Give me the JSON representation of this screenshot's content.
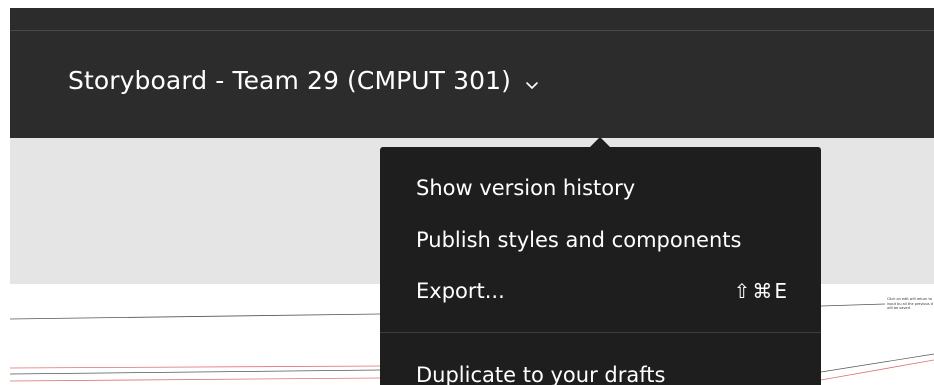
{
  "header": {
    "file_title": "Storyboard - Team 29 (CMPUT 301)",
    "title_chevron_icon": "chevron-down-icon"
  },
  "menu": {
    "items": [
      {
        "label": "Show version history",
        "shortcut": ""
      },
      {
        "label": "Publish styles and components",
        "shortcut": ""
      },
      {
        "label": "Export...",
        "shortcut": "⇧⌘E"
      },
      {
        "label": "Duplicate to your drafts",
        "shortcut": ""
      }
    ]
  },
  "canvas": {
    "note_text": "Click on edit will return to input bu all the previous d will be saved"
  },
  "colors": {
    "titlebar_bg": "#2c2c2c",
    "menu_bg": "#1e1e1e",
    "canvas_grey": "#e5e5e5"
  }
}
